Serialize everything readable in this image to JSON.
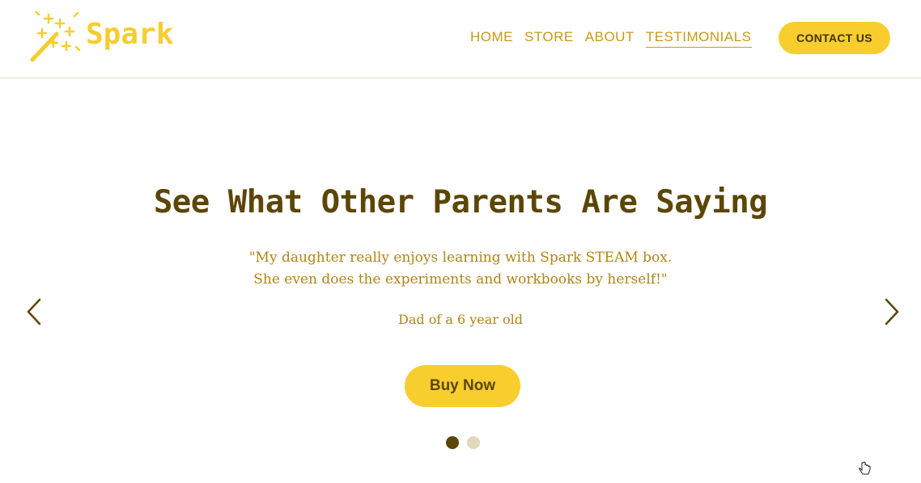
{
  "header": {
    "logo_text": "Spark",
    "nav": [
      {
        "label": "HOME",
        "active": false
      },
      {
        "label": "STORE",
        "active": false
      },
      {
        "label": "ABOUT",
        "active": false
      },
      {
        "label": "TESTIMONIALS",
        "active": true
      }
    ],
    "contact_label": "CONTACT US"
  },
  "slide": {
    "title": "See What Other Parents Are Saying",
    "quote_line1": "\"My daughter really enjoys learning with Spark STEAM box.",
    "quote_line2": "She even does the experiments and workbooks by herself!\"",
    "author": "Dad of a 6 year old",
    "cta_label": "Buy Now"
  },
  "carousel": {
    "prev_icon": "chevron-left-icon",
    "next_icon": "chevron-right-icon",
    "current_slide": 1,
    "total_slides": 2
  },
  "colors": {
    "brand_yellow": "#f8cd2e",
    "dark_brown": "#5c4607",
    "gold_text": "#c79a12"
  }
}
